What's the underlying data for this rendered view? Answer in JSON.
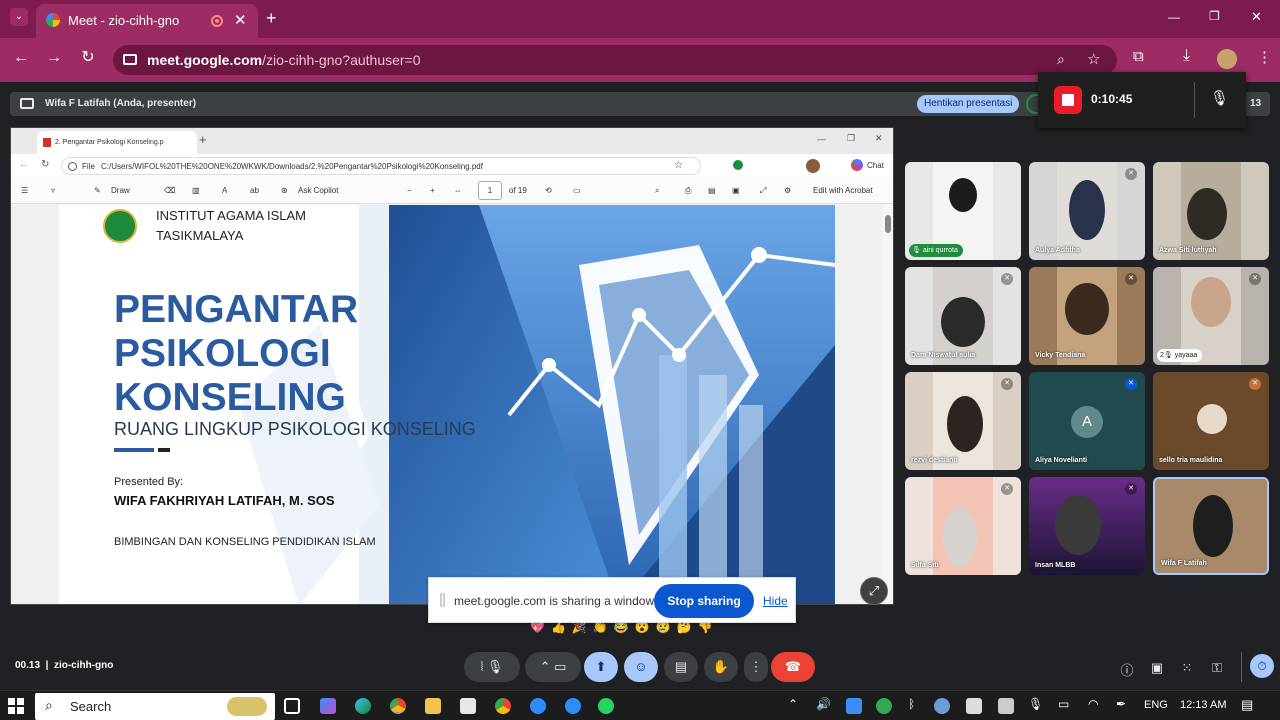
{
  "browser": {
    "tab_title": "Meet - zio-cihh-gno",
    "url_host": "meet.google.com",
    "url_path": "/zio-cihh-gno?authuser=0",
    "tab_close": "✕",
    "new_tab": "+",
    "min": "—",
    "restore": "❐",
    "close": "✕"
  },
  "meet": {
    "presenter_label": "Wifa F Latifah (Anda, presenter)",
    "stop_presenting": "Hentikan presentasi",
    "recording_time": "0:10:45",
    "time": "00.13",
    "meeting_code": "zio-cihh-gno",
    "participant_count": "13"
  },
  "shared_window": {
    "tab_title": "2. Pengantar Psikologi Konseling.p",
    "file_label": "File",
    "path": "C:/Users/WIFOL%20THE%20ONE%20WKWK/Downloads/2.%20Pengantar%20Psikologi%20Konseling.pdf",
    "chat": "Chat",
    "draw": "Draw",
    "ask_copilot": "Ask Copilot",
    "page_current": "1",
    "page_total": "of 19",
    "edit_acrobat": "Edit with Acrobat"
  },
  "slide": {
    "institution_1": "INSTITUT AGAMA ISLAM",
    "institution_2": "TASIKMALAYA",
    "title_1": "PENGANTAR",
    "title_2": "PSIKOLOGI",
    "title_3": "KONSELING",
    "subtitle": "RUANG LINGKUP PSIKOLOGI KONSELING",
    "presented_by": "Presented By:",
    "presenter": "WIFA FAKHRIYAH LATIFAH, M. SOS",
    "program": "BIMBINGAN DAN KONSELING PENDIDIKAN ISLAM"
  },
  "share_notice": {
    "text": "meet.google.com is sharing a window.",
    "stop": "Stop sharing",
    "hide": "Hide"
  },
  "participants": [
    {
      "name": "aini qurrota",
      "badge": "1"
    },
    {
      "name": "Aulya Adfitha"
    },
    {
      "name": "Azwa Siti lutfiyah"
    },
    {
      "name": "Dara Niswatul aulia"
    },
    {
      "name": "Vicky Tendiana"
    },
    {
      "name": "yayaaa",
      "badge": "2"
    },
    {
      "name": "rezvi destianti"
    },
    {
      "name": "Aliya Novelianti",
      "initial": "A"
    },
    {
      "name": "sello tria maulidina"
    },
    {
      "name": "Silfa Siti"
    },
    {
      "name": "Insan MLBB"
    },
    {
      "name": "Wifa F Latifah"
    }
  ],
  "taskbar": {
    "search": "Search",
    "lang": "ENG",
    "clock": "12:13 AM"
  },
  "colors": {
    "chrome_theme": "#7d1b4e",
    "slide_blue": "#2a5aa0",
    "meet_bg": "#202124",
    "stop_blue": "#0b57d0",
    "record_red": "#ea1c2b"
  }
}
